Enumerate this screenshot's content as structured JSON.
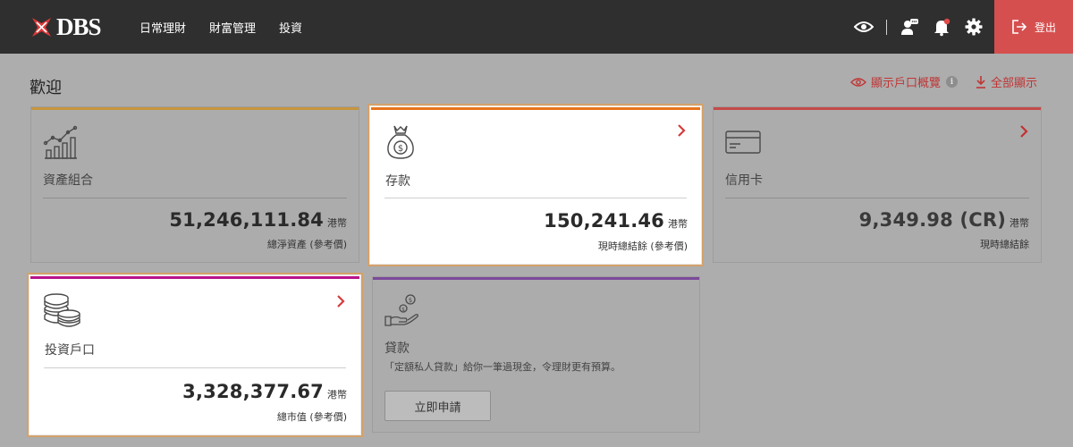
{
  "brand": {
    "name": "DBS"
  },
  "nav": {
    "items": [
      "日常理財",
      "財富管理",
      "投資"
    ]
  },
  "topbar": {
    "logout_label": "登出"
  },
  "page": {
    "title": "歡迎"
  },
  "header_actions": {
    "show_overview": "顯示戶口概覽",
    "info": "i",
    "show_all": "全部顯示"
  },
  "colors": {
    "accent": "#c03535",
    "portfolio_stripe": "#c7953f",
    "deposit_stripe": "#e8731a",
    "card_stripe": "#c44a4a",
    "invest_stripe": "#b8128a",
    "loan_stripe": "#7b4a9a"
  },
  "cards": {
    "portfolio": {
      "title": "資產組合",
      "amount": "51,246,111.84",
      "currency": "港幣",
      "note": "總淨資產 (參考價)"
    },
    "deposit": {
      "title": "存款",
      "amount": "150,241.46",
      "currency": "港幣",
      "note": "現時總結餘 (參考價)"
    },
    "credit": {
      "title": "信用卡",
      "amount": "9,349.98 (CR)",
      "currency": "港幣",
      "note": "現時總結餘"
    },
    "invest": {
      "title": "投資戶口",
      "amount": "3,328,377.67",
      "currency": "港幣",
      "note": "總市值 (參考價)"
    },
    "loan": {
      "title": "貸款",
      "description": "「定額私人貸款」給你一筆過現金，令理財更有預算。",
      "button": "立即申請"
    }
  }
}
